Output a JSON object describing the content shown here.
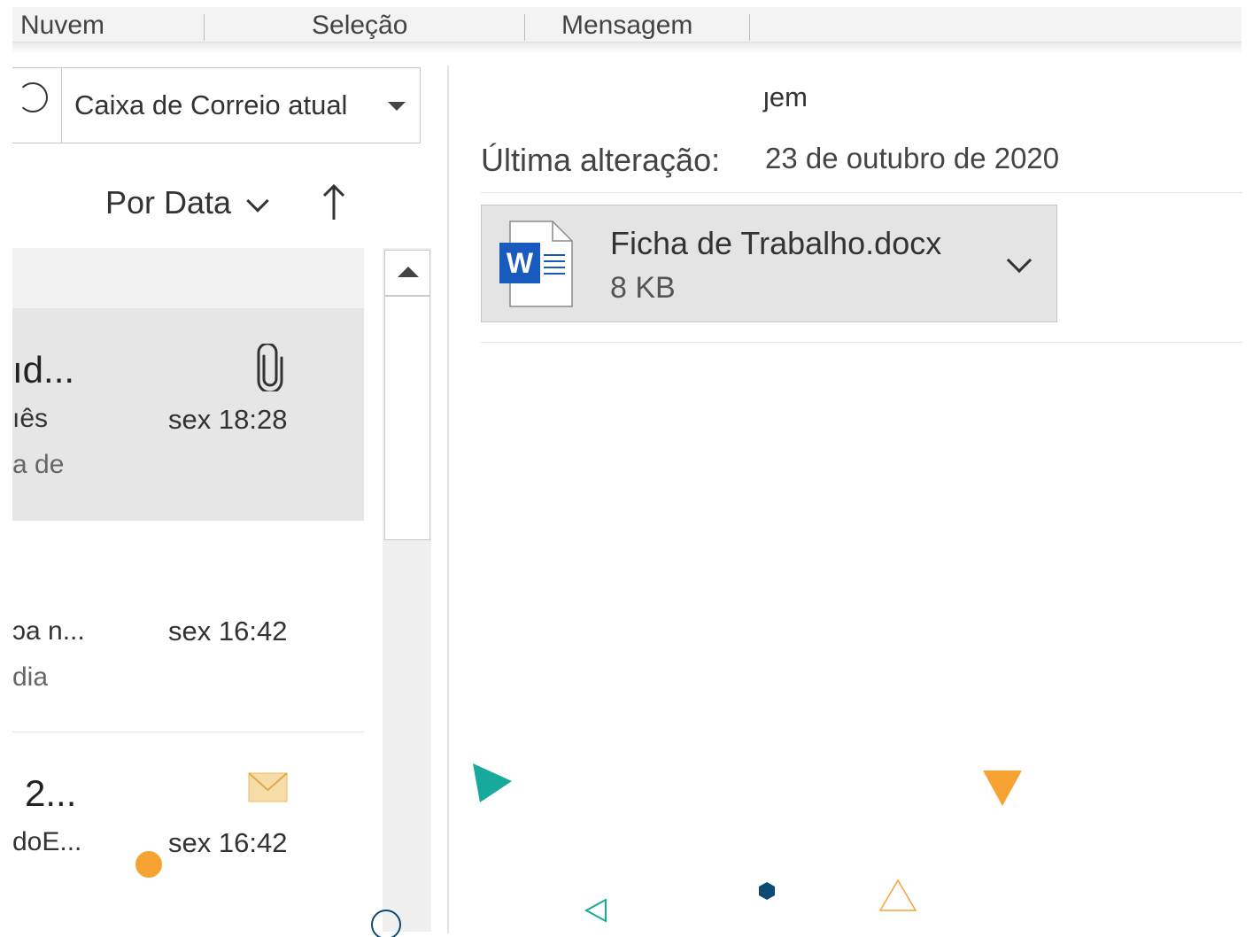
{
  "ribbon": {
    "groups": [
      "Nuvem",
      "Seleção",
      "Mensagem"
    ]
  },
  "search": {
    "scope_label": "Caixa de Correio atual"
  },
  "sort": {
    "label": "Por Data"
  },
  "messages": [
    {
      "sender": "ıd...",
      "subject": "ıês",
      "preview": "a de",
      "time": "sex 18:28",
      "icon": "paperclip-icon"
    },
    {
      "subject": "ɔa n...",
      "preview": "dia",
      "time": "sex 16:42"
    },
    {
      "sender": "2...",
      "subject": "doE...",
      "time": "sex 16:42",
      "icon": "envelope-icon"
    }
  ],
  "reading_pane": {
    "header_fragment": "ȷem",
    "last_modified_label": "Última alteração:",
    "last_modified_value": "23 de outubro de 2020",
    "attachment": {
      "name": "Ficha de Trabalho.docx",
      "size": "8 KB",
      "icon": "word-document-icon"
    }
  },
  "colors": {
    "accent_word_blue": "#185abd",
    "deco_teal": "#17a99b",
    "deco_orange": "#f7a334",
    "deco_navy": "#0b4a75",
    "envelope": "#f2c77b"
  }
}
